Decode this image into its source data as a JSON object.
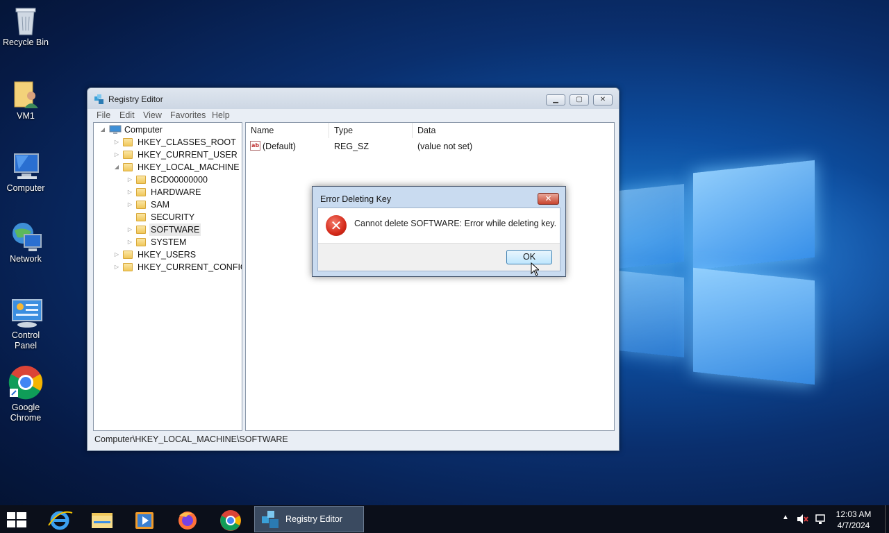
{
  "desktop": {
    "icons": [
      {
        "label": "Recycle Bin",
        "icon": "recycle-bin-icon"
      },
      {
        "label": "VM1",
        "icon": "user-folder-icon"
      },
      {
        "label": "Computer",
        "icon": "computer-icon"
      },
      {
        "label": "Network",
        "icon": "network-icon"
      },
      {
        "label": "Control Panel",
        "icon": "control-panel-icon"
      },
      {
        "label": "Google Chrome",
        "icon": "chrome-icon"
      }
    ]
  },
  "regedit": {
    "title": "Registry Editor",
    "menu": [
      "File",
      "Edit",
      "View",
      "Favorites",
      "Help"
    ],
    "tree": {
      "root": "Computer",
      "hives": [
        "HKEY_CLASSES_ROOT",
        "HKEY_CURRENT_USER",
        "HKEY_LOCAL_MACHINE",
        "HKEY_USERS",
        "HKEY_CURRENT_CONFIG"
      ],
      "hklm_children": [
        "BCD00000000",
        "HARDWARE",
        "SAM",
        "SECURITY",
        "SOFTWARE",
        "SYSTEM"
      ],
      "selected": "SOFTWARE"
    },
    "columns": [
      "Name",
      "Type",
      "Data"
    ],
    "values": [
      {
        "name": "(Default)",
        "type": "REG_SZ",
        "data": "(value not set)"
      }
    ],
    "status_path": "Computer\\HKEY_LOCAL_MACHINE\\SOFTWARE"
  },
  "dialog": {
    "title": "Error Deleting Key",
    "message": "Cannot delete SOFTWARE:  Error while deleting key.",
    "ok_label": "OK",
    "close_glyph": "✕",
    "error_glyph": "✕"
  },
  "taskbar": {
    "active_app": "Registry Editor",
    "pinned": [
      "internet-explorer-icon",
      "file-explorer-icon",
      "media-player-icon",
      "firefox-icon",
      "chrome-icon"
    ],
    "clock_time": "12:03 AM",
    "clock_date": "4/7/2024"
  }
}
